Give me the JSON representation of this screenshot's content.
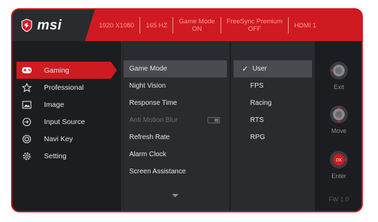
{
  "brand": {
    "name": "msi"
  },
  "header": {
    "items": [
      "1920 X1080",
      "165 HZ",
      "Game Mode\nON",
      "FreeSync Premium\nOFF",
      "HDMI 1"
    ]
  },
  "sidebar": {
    "items": [
      {
        "label": "Gaming",
        "icon": "gamepad-icon",
        "active": true
      },
      {
        "label": "Professional",
        "icon": "star-icon"
      },
      {
        "label": "Image",
        "icon": "image-icon"
      },
      {
        "label": "Input Source",
        "icon": "input-icon"
      },
      {
        "label": "Navi Key",
        "icon": "navi-key-icon"
      },
      {
        "label": "Setting",
        "icon": "setting-gear-icon"
      }
    ]
  },
  "middle": {
    "items": [
      {
        "label": "Game Mode",
        "selected": true
      },
      {
        "label": "Night Vision"
      },
      {
        "label": "Response Time"
      },
      {
        "label": "Anti Motion Blur",
        "disabled": true,
        "toggle": "off"
      },
      {
        "label": "Refresh Rate"
      },
      {
        "label": "Alarm Clock"
      },
      {
        "label": "Screen Assistance"
      }
    ]
  },
  "right": {
    "items": [
      {
        "label": "User",
        "selected": true
      },
      {
        "label": "FPS"
      },
      {
        "label": "Racing"
      },
      {
        "label": "RTS"
      },
      {
        "label": "RPG"
      }
    ]
  },
  "nav": {
    "exit_label": "Exit",
    "move_label": "Move",
    "enter_label": "Enter",
    "ok_text": "OK",
    "fw": "FW 1.0"
  },
  "colors": {
    "accent": "#d01a21",
    "panel": "#2a2b2e",
    "bg": "#1c1d20"
  }
}
